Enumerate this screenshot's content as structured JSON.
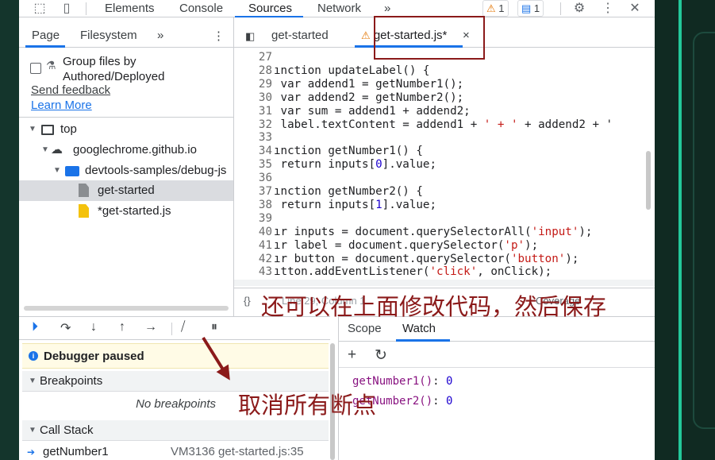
{
  "toolbar": {
    "tabs": [
      "Elements",
      "Console",
      "Sources",
      "Network"
    ],
    "more": "»",
    "warnings": "1",
    "messages": "1"
  },
  "navigator": {
    "tabs": [
      "Page",
      "Filesystem"
    ],
    "more": "»",
    "group_files": "Group files by Authored/Deployed",
    "send_feedback": "Send feedback",
    "learn_more": "Learn More",
    "tree": [
      "top",
      "googlechrome.github.io",
      "devtools-samples/debug-js",
      "get-started",
      "*get-started.js"
    ]
  },
  "editor": {
    "tabs": [
      "get-started",
      "get-started.js*"
    ],
    "lines": [
      {
        "n": "27",
        "t": ""
      },
      {
        "n": "28",
        "t": "ınction updateLabel() {"
      },
      {
        "n": "29",
        "t": " var addend1 = getNumber1();"
      },
      {
        "n": "30",
        "t": " var addend2 = getNumber2();"
      },
      {
        "n": "31",
        "t": " var sum = addend1 + addend2;"
      },
      {
        "n": "32",
        "t": " label.textContent = addend1 + ' + ' + addend2 + '"
      },
      {
        "n": "33",
        "t": ""
      },
      {
        "n": "34",
        "t": "ınction getNumber1() {"
      },
      {
        "n": "35",
        "t": " return inputs[0].value;"
      },
      {
        "n": "36",
        "t": ""
      },
      {
        "n": "37",
        "t": "ınction getNumber2() {"
      },
      {
        "n": "38",
        "t": " return inputs[1].value;"
      },
      {
        "n": "39",
        "t": ""
      },
      {
        "n": "40",
        "t": "ır inputs = document.querySelectorAll('input');"
      },
      {
        "n": "41",
        "t": "ır label = document.querySelector('p');"
      },
      {
        "n": "42",
        "t": "ır button = document.querySelector('button');"
      },
      {
        "n": "43",
        "t": "ıtton.addEventListener('click', onClick);"
      }
    ],
    "status_left": "{}",
    "status_mid": "Line 29, Column 1",
    "status_right": "Coverage"
  },
  "debugger": {
    "paused": "Debugger paused",
    "breakpoints": "Breakpoints",
    "no_breakpoints": "No breakpoints",
    "call_stack": "Call Stack",
    "frame_name": "getNumber1",
    "frame_loc": "VM3136 get-started.js:35"
  },
  "watch_pane": {
    "tabs": [
      "Scope",
      "Watch"
    ],
    "rows": [
      {
        "name": "getNumber1()",
        "value": "0"
      },
      {
        "name": "getNumber2()",
        "value": "0"
      }
    ]
  },
  "annotations": {
    "edit_note": "还可以在上面修改代码，然后保存",
    "bp_note": "取消所有断点"
  }
}
